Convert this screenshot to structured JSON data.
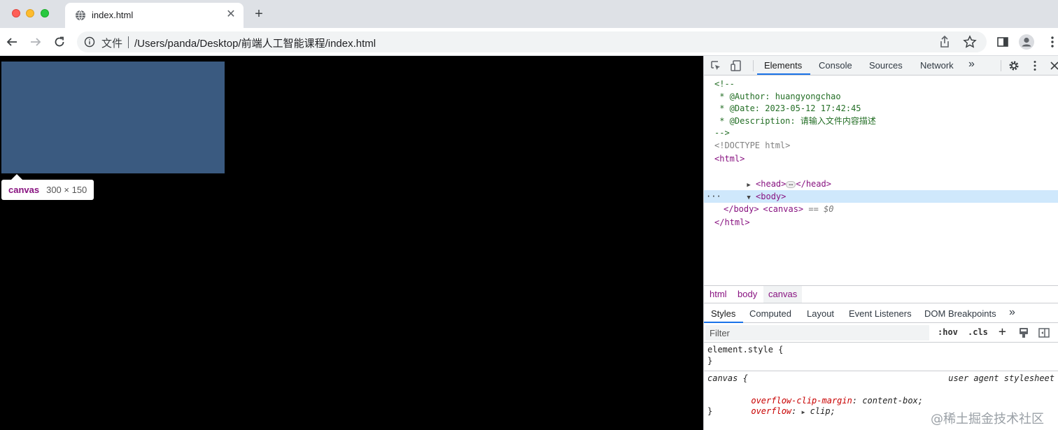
{
  "browser": {
    "tab_title": "index.html",
    "tab_close": "✕",
    "new_tab": "+",
    "security_label": "文件",
    "url": "/Users/panda/Desktop/前端人工智能课程/index.html"
  },
  "viewport": {
    "canvas_color": "#3a5a80",
    "tooltip_tag": "canvas",
    "tooltip_size": "300 × 150"
  },
  "devtools": {
    "tabs": [
      "Elements",
      "Console",
      "Sources",
      "Network"
    ],
    "more_tabs": "»",
    "dom": {
      "comment_open": "<!--",
      "author": " * @Author: huangyongchao",
      "date": " * @Date: 2023-05-12 17:42:45",
      "description": " * @Description: 请输入文件内容描述",
      "comment_close": "-->",
      "doctype": "<!DOCTYPE html>",
      "html_open": "<html>",
      "head_open": "<head>",
      "head_close": "</head>",
      "body_open": "<body>",
      "canvas": "<canvas>",
      "selected_marker": "== $0",
      "body_close": "</body>",
      "html_close": "</html>",
      "row_dots": "···"
    },
    "breadcrumbs": [
      "html",
      "body",
      "canvas"
    ],
    "styles_tabs": [
      "Styles",
      "Computed",
      "Layout",
      "Event Listeners",
      "DOM Breakpoints"
    ],
    "styles_more": "»",
    "filter_placeholder": "Filter",
    "hov": ":hov",
    "cls": ".cls",
    "plus": "+",
    "rules": {
      "element_style": "element.style {",
      "close_brace": "}",
      "canvas_selector": "canvas {",
      "ua_label": "user agent stylesheet",
      "prop1_name": "overflow-clip-margin",
      "prop1_value": "content-box;",
      "prop2_name": "overflow",
      "prop2_value": "clip;"
    }
  },
  "watermark": "@稀土掘金技术社区"
}
